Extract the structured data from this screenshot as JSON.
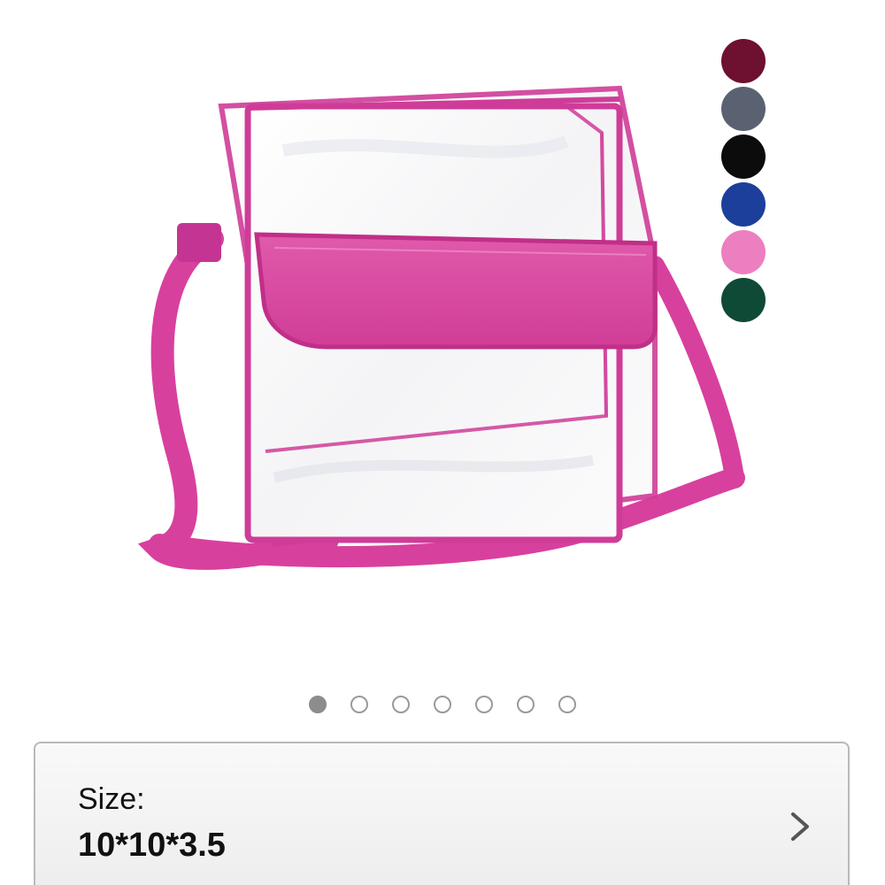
{
  "product": {
    "image_icon": "clear-pink-crossbody-bag"
  },
  "swatches": [
    {
      "name": "burgundy",
      "color": "#6e1030"
    },
    {
      "name": "gray",
      "color": "#5a6272"
    },
    {
      "name": "black",
      "color": "#0c0c0c"
    },
    {
      "name": "blue",
      "color": "#1c3f9c"
    },
    {
      "name": "pink",
      "color": "#ec7fbf"
    },
    {
      "name": "dark-green",
      "color": "#0f4a36"
    }
  ],
  "carousel": {
    "total": 7,
    "active_index": 0
  },
  "size": {
    "label": "Size:",
    "value": "10*10*3.5",
    "chevron_icon": "chevron-right-icon"
  },
  "colors": {
    "accent_pink": "#d23e9f",
    "card_border": "#b9b9b9"
  }
}
